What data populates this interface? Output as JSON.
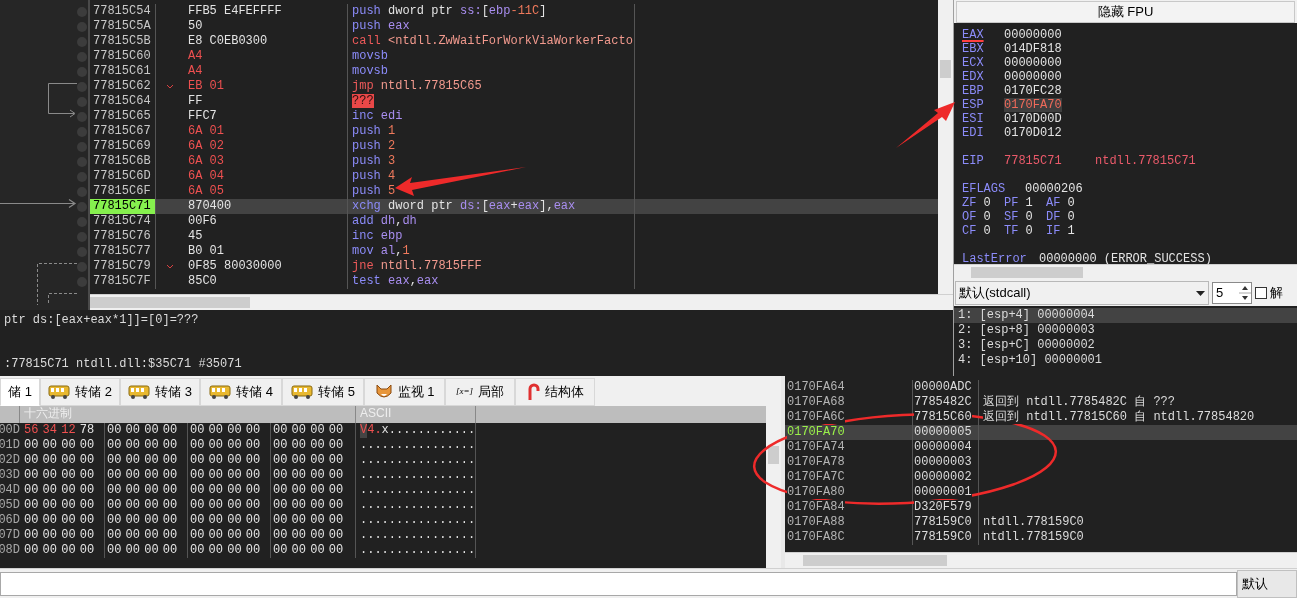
{
  "disassembly": {
    "rows": [
      {
        "address": "77815C54",
        "bytes": "FFB5 E4FEFFFF",
        "highlighted": false,
        "jump": false,
        "selected": false,
        "instruction": [
          {
            "text": "push",
            "kind": "mnemonic"
          },
          {
            "text": " dword ptr ",
            "kind": "plain"
          },
          {
            "text": "ss:",
            "kind": "register"
          },
          {
            "text": "[",
            "kind": "plain"
          },
          {
            "text": "ebp",
            "kind": "register"
          },
          {
            "text": "-11C",
            "kind": "number"
          },
          {
            "text": "]",
            "kind": "plain"
          }
        ]
      },
      {
        "address": "77815C5A",
        "bytes": "50",
        "highlighted": false,
        "jump": false,
        "selected": false,
        "instruction": [
          {
            "text": "push",
            "kind": "mnemonic"
          },
          {
            "text": " eax",
            "kind": "register"
          }
        ]
      },
      {
        "address": "77815C5B",
        "bytes": "E8 C0EB0300",
        "highlighted": false,
        "jump": false,
        "selected": false,
        "instruction": [
          {
            "text": "call",
            "kind": "branch"
          },
          {
            "text": " <ntdll.ZwWaitForWorkViaWorkerFacto",
            "kind": "target"
          }
        ]
      },
      {
        "address": "77815C60",
        "bytes": "A4",
        "highlighted": true,
        "jump": false,
        "selected": false,
        "instruction": [
          {
            "text": "movsb",
            "kind": "mnemonic"
          }
        ]
      },
      {
        "address": "77815C61",
        "bytes": "A4",
        "highlighted": true,
        "jump": false,
        "selected": false,
        "instruction": [
          {
            "text": "movsb",
            "kind": "mnemonic"
          }
        ]
      },
      {
        "address": "77815C62",
        "bytes": "EB 01",
        "highlighted": true,
        "jump": true,
        "selected": false,
        "instruction": [
          {
            "text": "jmp",
            "kind": "branch"
          },
          {
            "text": " ntdll.77815C65",
            "kind": "target"
          }
        ]
      },
      {
        "address": "77815C64",
        "bytes": "FF",
        "highlighted": false,
        "jump": false,
        "selected": false,
        "instruction": [
          {
            "text": "???",
            "kind": "invalid"
          }
        ]
      },
      {
        "address": "77815C65",
        "bytes": "FFC7",
        "highlighted": false,
        "jump": false,
        "selected": false,
        "instruction": [
          {
            "text": "inc",
            "kind": "mnemonic"
          },
          {
            "text": " edi",
            "kind": "register"
          }
        ]
      },
      {
        "address": "77815C67",
        "bytes": "6A 01",
        "highlighted": true,
        "jump": false,
        "selected": false,
        "instruction": [
          {
            "text": "push",
            "kind": "mnemonic"
          },
          {
            "text": " 1",
            "kind": "number"
          }
        ]
      },
      {
        "address": "77815C69",
        "bytes": "6A 02",
        "highlighted": true,
        "jump": false,
        "selected": false,
        "instruction": [
          {
            "text": "push",
            "kind": "mnemonic"
          },
          {
            "text": " 2",
            "kind": "number"
          }
        ]
      },
      {
        "address": "77815C6B",
        "bytes": "6A 03",
        "highlighted": true,
        "jump": false,
        "selected": false,
        "instruction": [
          {
            "text": "push",
            "kind": "mnemonic"
          },
          {
            "text": " 3",
            "kind": "number"
          }
        ]
      },
      {
        "address": "77815C6D",
        "bytes": "6A 04",
        "highlighted": true,
        "jump": false,
        "selected": false,
        "instruction": [
          {
            "text": "push",
            "kind": "mnemonic"
          },
          {
            "text": " 4",
            "kind": "number"
          }
        ]
      },
      {
        "address": "77815C6F",
        "bytes": "6A 05",
        "highlighted": true,
        "jump": false,
        "selected": false,
        "instruction": [
          {
            "text": "push",
            "kind": "mnemonic"
          },
          {
            "text": " 5",
            "kind": "number"
          }
        ]
      },
      {
        "address": "77815C71",
        "bytes": "870400",
        "highlighted": false,
        "jump": false,
        "selected": true,
        "instruction": [
          {
            "text": "xchg",
            "kind": "mnemonic"
          },
          {
            "text": " dword ptr ",
            "kind": "plain"
          },
          {
            "text": "ds:",
            "kind": "register"
          },
          {
            "text": "[",
            "kind": "plain"
          },
          {
            "text": "eax",
            "kind": "register"
          },
          {
            "text": "+",
            "kind": "plain"
          },
          {
            "text": "eax",
            "kind": "register"
          },
          {
            "text": "],",
            "kind": "plain"
          },
          {
            "text": "eax",
            "kind": "register"
          }
        ]
      },
      {
        "address": "77815C74",
        "bytes": "00F6",
        "highlighted": false,
        "jump": false,
        "selected": false,
        "instruction": [
          {
            "text": "add",
            "kind": "mnemonic"
          },
          {
            "text": " dh",
            "kind": "register"
          },
          {
            "text": ",",
            "kind": "plain"
          },
          {
            "text": "dh",
            "kind": "register"
          }
        ]
      },
      {
        "address": "77815C76",
        "bytes": "45",
        "highlighted": false,
        "jump": false,
        "selected": false,
        "instruction": [
          {
            "text": "inc",
            "kind": "mnemonic"
          },
          {
            "text": " ebp",
            "kind": "register"
          }
        ]
      },
      {
        "address": "77815C77",
        "bytes": "B0 01",
        "highlighted": false,
        "jump": false,
        "selected": false,
        "instruction": [
          {
            "text": "mov",
            "kind": "mnemonic"
          },
          {
            "text": " al",
            "kind": "register"
          },
          {
            "text": ",",
            "kind": "plain"
          },
          {
            "text": "1",
            "kind": "number"
          }
        ]
      },
      {
        "address": "77815C79",
        "bytes": "0F85 80030000",
        "highlighted": false,
        "jump": true,
        "selected": false,
        "instruction": [
          {
            "text": "jne",
            "kind": "branch"
          },
          {
            "text": " ntdll.77815FFF",
            "kind": "target"
          }
        ]
      },
      {
        "address": "77815C7F",
        "bytes": "85C0",
        "highlighted": false,
        "jump": false,
        "selected": false,
        "instruction": [
          {
            "text": "test",
            "kind": "mnemonic"
          },
          {
            "text": " eax",
            "kind": "register"
          },
          {
            "text": ",",
            "kind": "plain"
          },
          {
            "text": "eax",
            "kind": "register"
          }
        ]
      }
    ]
  },
  "info_panel": {
    "lines": [
      "ptr ds:[eax+eax*1]]=[0]=???",
      ":77815C71 ntdll.dll:$35C71 #35071"
    ]
  },
  "registers_panel": {
    "header": "隐藏 FPU",
    "general": [
      {
        "name": "EAX",
        "value": "00000000",
        "selected": true,
        "modified": false
      },
      {
        "name": "EBX",
        "value": "014DF818",
        "selected": false,
        "modified": false
      },
      {
        "name": "ECX",
        "value": "00000000",
        "selected": false,
        "modified": false
      },
      {
        "name": "EDX",
        "value": "00000000",
        "selected": false,
        "modified": false
      },
      {
        "name": "EBP",
        "value": "0170FC28",
        "selected": false,
        "modified": false
      },
      {
        "name": "ESP",
        "value": "0170FA70",
        "selected": false,
        "modified": true
      },
      {
        "name": "ESI",
        "value": "0170D00D",
        "selected": false,
        "modified": false
      },
      {
        "name": "EDI",
        "value": "0170D012",
        "selected": false,
        "modified": false
      }
    ],
    "eip": {
      "name": "EIP",
      "value": "77815C71",
      "comment": "ntdll.77815C71"
    },
    "eflags": {
      "name": "EFLAGS",
      "value": "00000206"
    },
    "flags": [
      {
        "name": "ZF",
        "value": "0"
      },
      {
        "name": "PF",
        "value": "1"
      },
      {
        "name": "AF",
        "value": "0"
      },
      {
        "name": "OF",
        "value": "0"
      },
      {
        "name": "SF",
        "value": "0"
      },
      {
        "name": "DF",
        "value": "0"
      },
      {
        "name": "CF",
        "value": "0"
      },
      {
        "name": "TF",
        "value": "0"
      },
      {
        "name": "IF",
        "value": "1"
      }
    ],
    "last_error": {
      "name": "LastError",
      "value": "00000000 (ERROR_SUCCESS)"
    }
  },
  "arguments": {
    "convention": "默认(stdcall)",
    "count": "5",
    "lock": {
      "label": "解",
      "checked": false
    },
    "rows": [
      {
        "text": "1: [esp+4] 00000004",
        "selected": true
      },
      {
        "text": "2: [esp+8] 00000003",
        "selected": false
      },
      {
        "text": "3: [esp+C] 00000002",
        "selected": false
      },
      {
        "text": "4: [esp+10] 00000001",
        "selected": false
      }
    ]
  },
  "dump_tabs": [
    {
      "label": "储 1",
      "kind": "none",
      "selected": true
    },
    {
      "label": "转储 2",
      "kind": "dump",
      "selected": false
    },
    {
      "label": "转储 3",
      "kind": "dump",
      "selected": false
    },
    {
      "label": "转储 4",
      "kind": "dump",
      "selected": false
    },
    {
      "label": "转储 5",
      "kind": "dump",
      "selected": false
    },
    {
      "label": "监视 1",
      "kind": "watch",
      "selected": false
    },
    {
      "label": "局部",
      "kind": "locals",
      "icon_text": "[x=]",
      "selected": false
    },
    {
      "label": "结构体",
      "kind": "struct",
      "selected": false
    }
  ],
  "hex_dump": {
    "columns": [
      "十六进制",
      "ASCII"
    ],
    "rows": [
      {
        "address": "00D",
        "bytes": [
          "56",
          "34",
          "12",
          "78",
          "00",
          "00",
          "00",
          "00",
          "00",
          "00",
          "00",
          "00",
          "00",
          "00",
          "00",
          "00"
        ],
        "changed": [
          true,
          true,
          true,
          false,
          false,
          false,
          false,
          false,
          false,
          false,
          false,
          false,
          false,
          false,
          false,
          false
        ],
        "ascii": "V4.x............"
      },
      {
        "address": "01D",
        "bytes": [
          "00",
          "00",
          "00",
          "00",
          "00",
          "00",
          "00",
          "00",
          "00",
          "00",
          "00",
          "00",
          "00",
          "00",
          "00",
          "00"
        ],
        "changed": [
          false,
          false,
          false,
          false,
          false,
          false,
          false,
          false,
          false,
          false,
          false,
          false,
          false,
          false,
          false,
          false
        ],
        "ascii": "................"
      },
      {
        "address": "02D",
        "bytes": [
          "00",
          "00",
          "00",
          "00",
          "00",
          "00",
          "00",
          "00",
          "00",
          "00",
          "00",
          "00",
          "00",
          "00",
          "00",
          "00"
        ],
        "changed": [
          false,
          false,
          false,
          false,
          false,
          false,
          false,
          false,
          false,
          false,
          false,
          false,
          false,
          false,
          false,
          false
        ],
        "ascii": "................"
      },
      {
        "address": "03D",
        "bytes": [
          "00",
          "00",
          "00",
          "00",
          "00",
          "00",
          "00",
          "00",
          "00",
          "00",
          "00",
          "00",
          "00",
          "00",
          "00",
          "00"
        ],
        "changed": [
          false,
          false,
          false,
          false,
          false,
          false,
          false,
          false,
          false,
          false,
          false,
          false,
          false,
          false,
          false,
          false
        ],
        "ascii": "................"
      },
      {
        "address": "04D",
        "bytes": [
          "00",
          "00",
          "00",
          "00",
          "00",
          "00",
          "00",
          "00",
          "00",
          "00",
          "00",
          "00",
          "00",
          "00",
          "00",
          "00"
        ],
        "changed": [
          false,
          false,
          false,
          false,
          false,
          false,
          false,
          false,
          false,
          false,
          false,
          false,
          false,
          false,
          false,
          false
        ],
        "ascii": "................"
      },
      {
        "address": "05D",
        "bytes": [
          "00",
          "00",
          "00",
          "00",
          "00",
          "00",
          "00",
          "00",
          "00",
          "00",
          "00",
          "00",
          "00",
          "00",
          "00",
          "00"
        ],
        "changed": [
          false,
          false,
          false,
          false,
          false,
          false,
          false,
          false,
          false,
          false,
          false,
          false,
          false,
          false,
          false,
          false
        ],
        "ascii": "................"
      },
      {
        "address": "06D",
        "bytes": [
          "00",
          "00",
          "00",
          "00",
          "00",
          "00",
          "00",
          "00",
          "00",
          "00",
          "00",
          "00",
          "00",
          "00",
          "00",
          "00"
        ],
        "changed": [
          false,
          false,
          false,
          false,
          false,
          false,
          false,
          false,
          false,
          false,
          false,
          false,
          false,
          false,
          false,
          false
        ],
        "ascii": "................"
      },
      {
        "address": "07D",
        "bytes": [
          "00",
          "00",
          "00",
          "00",
          "00",
          "00",
          "00",
          "00",
          "00",
          "00",
          "00",
          "00",
          "00",
          "00",
          "00",
          "00"
        ],
        "changed": [
          false,
          false,
          false,
          false,
          false,
          false,
          false,
          false,
          false,
          false,
          false,
          false,
          false,
          false,
          false,
          false
        ],
        "ascii": "................"
      },
      {
        "address": "08D",
        "bytes": [
          "00",
          "00",
          "00",
          "00",
          "00",
          "00",
          "00",
          "00",
          "00",
          "00",
          "00",
          "00",
          "00",
          "00",
          "00",
          "00"
        ],
        "changed": [
          false,
          false,
          false,
          false,
          false,
          false,
          false,
          false,
          false,
          false,
          false,
          false,
          false,
          false,
          false,
          false
        ],
        "ascii": "................"
      }
    ]
  },
  "stack": {
    "rows": [
      {
        "address": "0170FA64",
        "value": "00000ADC",
        "selected": false
      },
      {
        "address": "0170FA68",
        "value": "7785482C",
        "comment": "返回到 ntdll.7785482C 自 ???",
        "selected": false
      },
      {
        "address": "0170FA6C",
        "value": "77815C60",
        "comment": "返回到 ntdll.77815C60 自 ntdll.77854820",
        "selected": false
      },
      {
        "address": "0170FA70",
        "value": "00000005",
        "selected": true
      },
      {
        "address": "0170FA74",
        "value": "00000004",
        "selected": false
      },
      {
        "address": "0170FA78",
        "value": "00000003",
        "selected": false
      },
      {
        "address": "0170FA7C",
        "value": "00000002",
        "selected": false
      },
      {
        "address": "0170FA80",
        "value": "00000001",
        "selected": false
      },
      {
        "address": "0170FA84",
        "value": "D320F579",
        "selected": false
      },
      {
        "address": "0170FA88",
        "value": "778159C0",
        "comment": "ntdll.778159C0",
        "selected": false
      },
      {
        "address": "0170FA8C",
        "value": "778159C0",
        "comment": "ntdll.778159C0",
        "selected": false
      }
    ]
  },
  "command_bar": {
    "button": "默认"
  }
}
